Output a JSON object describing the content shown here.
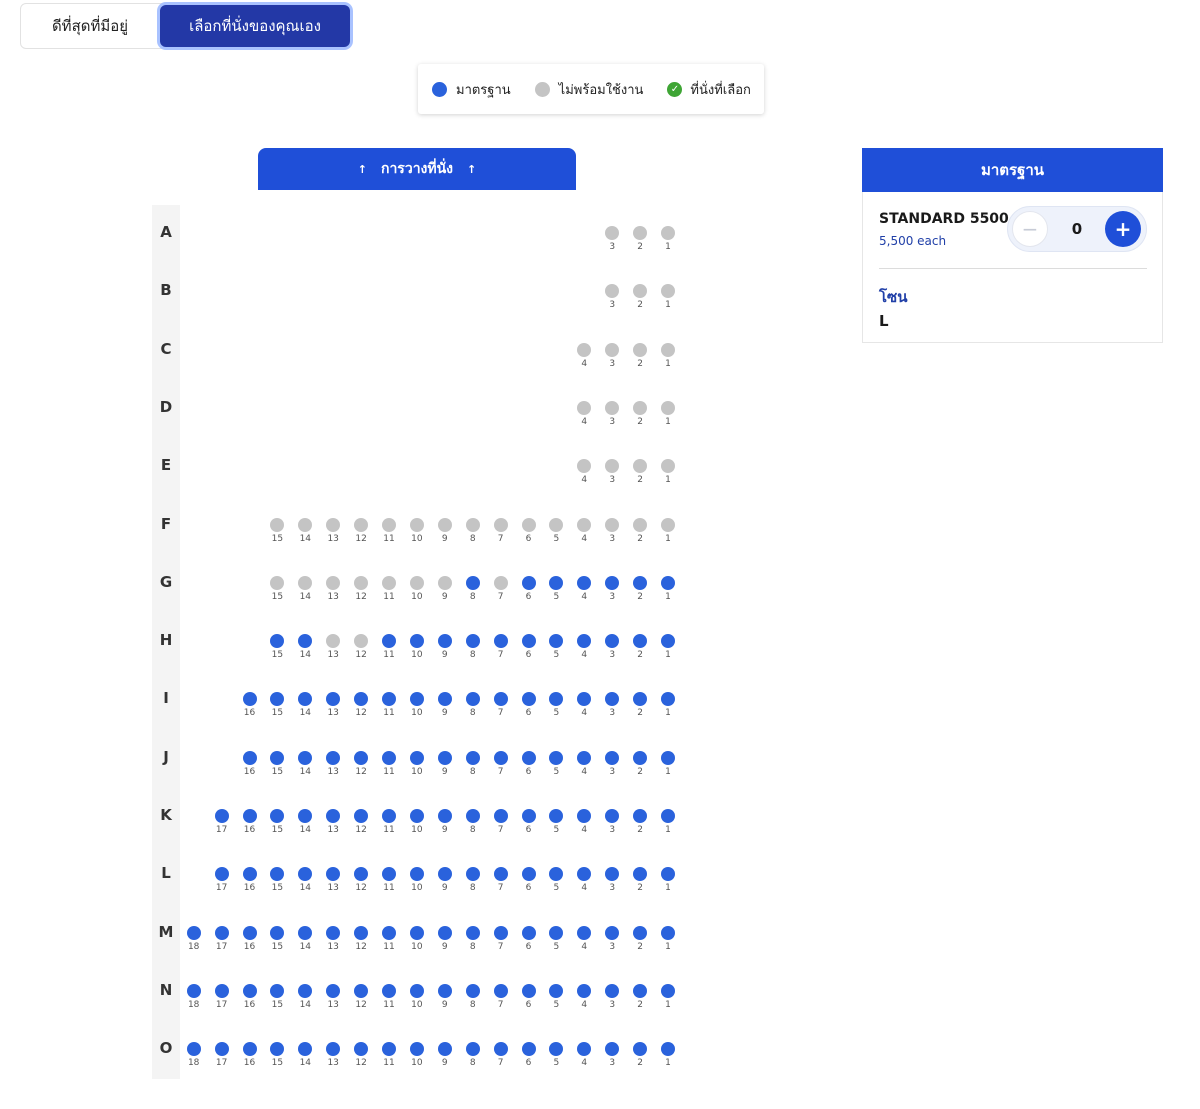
{
  "colors": {
    "standard": "#2a62dc",
    "unavailable": "#c4c4c4",
    "selected": "#3fa535",
    "accent": "#1f4fd8",
    "toggle_active": "#2338a6"
  },
  "mode_toggle": {
    "best_available_label": "ดีที่สุดที่มีอยู่",
    "choose_own_label": "เลือกที่นั่งของคุณเอง",
    "active": "choose_own"
  },
  "legend": {
    "standard_label": "มาตรฐาน",
    "unavailable_label": "ไม่พร้อมใช้งาน",
    "selected_label": "ที่นั่งที่เลือก",
    "selected_icon": "check-circle-icon"
  },
  "stage": {
    "label": "การวางที่นั่ง",
    "arrow_glyph": "↑"
  },
  "seatmap": {
    "rows": [
      {
        "label": "A",
        "seats": [
          3,
          2,
          1
        ],
        "available": []
      },
      {
        "label": "B",
        "seats": [
          3,
          2,
          1
        ],
        "available": []
      },
      {
        "label": "C",
        "seats": [
          4,
          3,
          2,
          1
        ],
        "available": []
      },
      {
        "label": "D",
        "seats": [
          4,
          3,
          2,
          1
        ],
        "available": []
      },
      {
        "label": "E",
        "seats": [
          4,
          3,
          2,
          1
        ],
        "available": []
      },
      {
        "label": "F",
        "seats": [
          15,
          14,
          13,
          12,
          11,
          10,
          9,
          8,
          7,
          6,
          5,
          4,
          3,
          2,
          1
        ],
        "available": []
      },
      {
        "label": "G",
        "seats": [
          15,
          14,
          13,
          12,
          11,
          10,
          9,
          8,
          7,
          6,
          5,
          4,
          3,
          2,
          1
        ],
        "available": [
          8,
          6,
          5,
          4,
          3,
          2,
          1
        ]
      },
      {
        "label": "H",
        "seats": [
          15,
          14,
          13,
          12,
          11,
          10,
          9,
          8,
          7,
          6,
          5,
          4,
          3,
          2,
          1
        ],
        "available": [
          15,
          14,
          11,
          10,
          9,
          8,
          7,
          6,
          5,
          4,
          3,
          2,
          1
        ]
      },
      {
        "label": "I",
        "seats": [
          16,
          15,
          14,
          13,
          12,
          11,
          10,
          9,
          8,
          7,
          6,
          5,
          4,
          3,
          2,
          1
        ],
        "available": "all"
      },
      {
        "label": "J",
        "seats": [
          16,
          15,
          14,
          13,
          12,
          11,
          10,
          9,
          8,
          7,
          6,
          5,
          4,
          3,
          2,
          1
        ],
        "available": "all"
      },
      {
        "label": "K",
        "seats": [
          17,
          16,
          15,
          14,
          13,
          12,
          11,
          10,
          9,
          8,
          7,
          6,
          5,
          4,
          3,
          2,
          1
        ],
        "available": "all"
      },
      {
        "label": "L",
        "seats": [
          17,
          16,
          15,
          14,
          13,
          12,
          11,
          10,
          9,
          8,
          7,
          6,
          5,
          4,
          3,
          2,
          1
        ],
        "available": "all"
      },
      {
        "label": "M",
        "seats": [
          18,
          17,
          16,
          15,
          14,
          13,
          12,
          11,
          10,
          9,
          8,
          7,
          6,
          5,
          4,
          3,
          2,
          1
        ],
        "available": "all"
      },
      {
        "label": "N",
        "seats": [
          18,
          17,
          16,
          15,
          14,
          13,
          12,
          11,
          10,
          9,
          8,
          7,
          6,
          5,
          4,
          3,
          2,
          1
        ],
        "available": "all"
      },
      {
        "label": "O",
        "seats": [
          18,
          17,
          16,
          15,
          14,
          13,
          12,
          11,
          10,
          9,
          8,
          7,
          6,
          5,
          4,
          3,
          2,
          1
        ],
        "available": "all"
      }
    ]
  },
  "panel": {
    "header": "มาตรฐาน",
    "ticket_name": "STANDARD 5500",
    "ticket_price": "5,500 each",
    "quantity": "0",
    "minus_glyph": "−",
    "plus_glyph": "+",
    "zone_label": "โซน",
    "zone_value": "L"
  }
}
